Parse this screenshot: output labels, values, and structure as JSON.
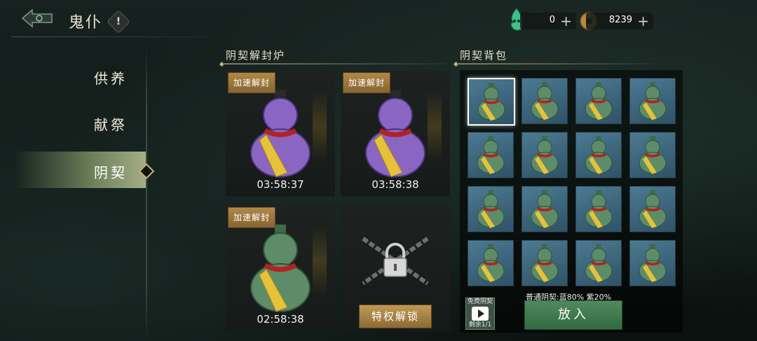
{
  "header": {
    "title": "鬼仆",
    "help_label": "!",
    "currencies": [
      {
        "icon": "soul-flame-icon",
        "value": "0",
        "plus": "+"
      },
      {
        "icon": "copper-coin-icon",
        "value": "8239",
        "plus": "+"
      }
    ]
  },
  "sidebar": {
    "items": [
      {
        "label": "供养",
        "active": false
      },
      {
        "label": "献祭",
        "active": false
      },
      {
        "label": "阴契",
        "active": true
      }
    ]
  },
  "furnace": {
    "title": "阴契解封炉",
    "slots": [
      {
        "badge": "加速解封",
        "timer": "03:58:37",
        "item": "purple-gourd-icon"
      },
      {
        "badge": "加速解封",
        "timer": "03:58:38",
        "item": "purple-gourd-icon"
      },
      {
        "badge": "加速解封",
        "timer": "02:58:38",
        "item": "green-gourd-icon"
      },
      {
        "locked": true,
        "unlock_label": "特权解锁",
        "item": "chained-lock-icon"
      }
    ]
  },
  "bag": {
    "title": "阴契背包",
    "cell_count": 16,
    "item": "blue-gourd-icon",
    "selected_index": 0,
    "rate_text": "普通阴契:蓝80% 紫20%",
    "ad_button": {
      "top": "免费阴契",
      "bottom": "剩余1/1"
    },
    "put_label": "放入"
  },
  "colors": {
    "accent_gold": "#c8b27a",
    "active_tab": "#a3ae86",
    "cell_blue": "#4c7a93",
    "put_green": "#4f8a5d",
    "purple_gourd": "#8a66c2",
    "green_gourd": "#5e8c68"
  }
}
